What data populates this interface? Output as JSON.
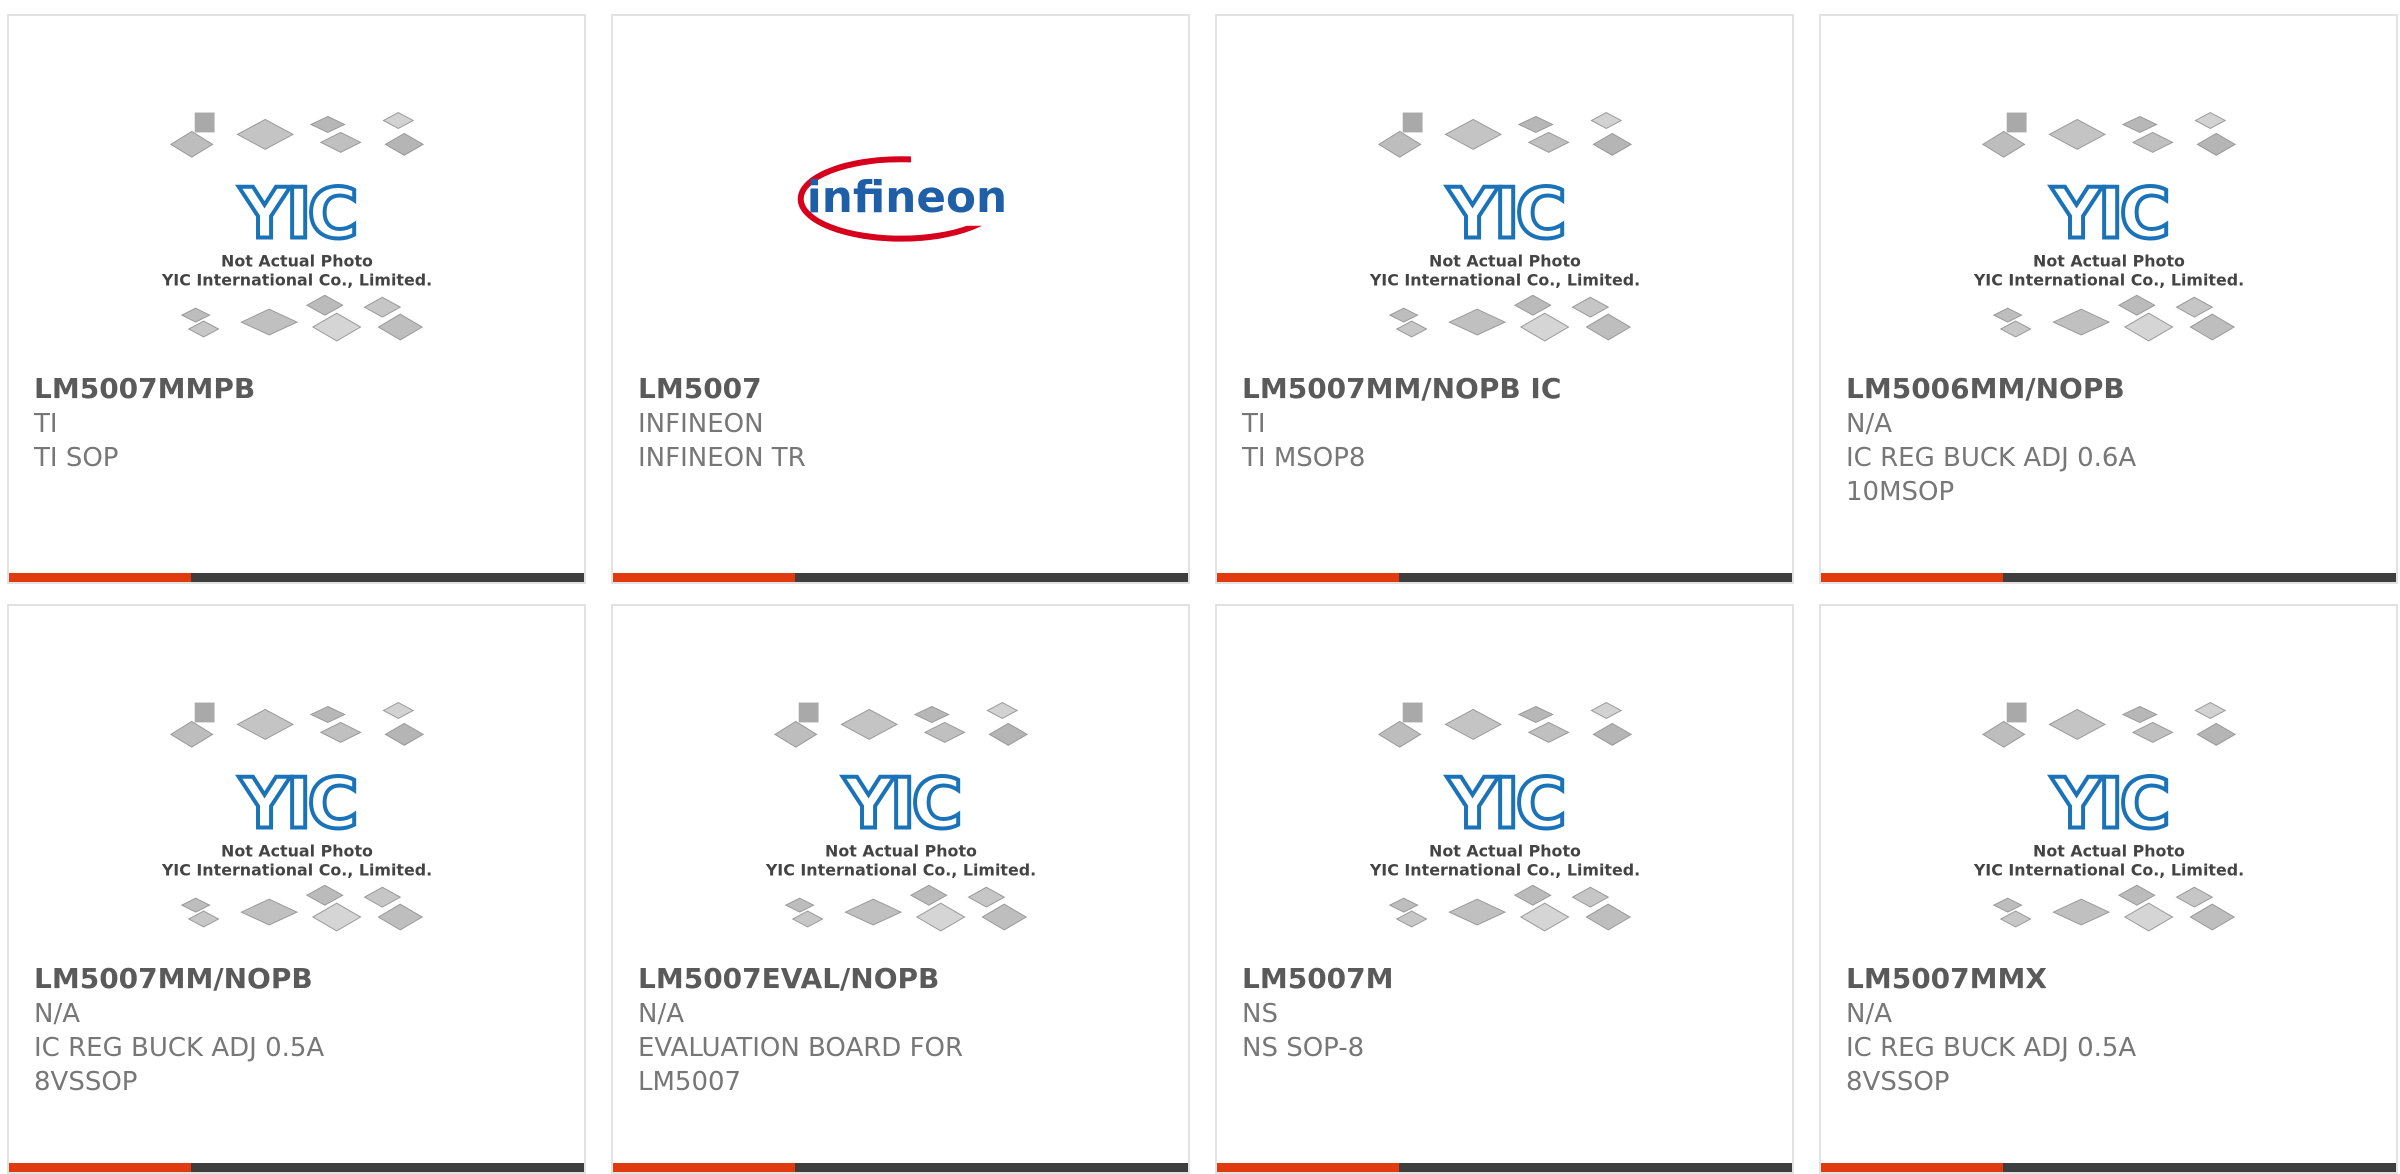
{
  "products": [
    {
      "part": "LM5007MMPB",
      "manufacturer": "TI",
      "description": "TI SOP",
      "image": "yic-placeholder"
    },
    {
      "part": "LM5007",
      "manufacturer": "INFINEON",
      "description": "INFINEON TR",
      "image": "infineon-logo"
    },
    {
      "part": "LM5007MM/NOPB IC",
      "manufacturer": "TI",
      "description": "TI MSOP8",
      "image": "yic-placeholder"
    },
    {
      "part": "LM5006MM/NOPB",
      "manufacturer": "N/A",
      "description": "IC REG BUCK ADJ 0.6A 10MSOP",
      "image": "yic-placeholder"
    },
    {
      "part": "LM5007MM/NOPB",
      "manufacturer": "N/A",
      "description": "IC REG BUCK ADJ 0.5A 8VSSOP",
      "image": "yic-placeholder"
    },
    {
      "part": "LM5007EVAL/NOPB",
      "manufacturer": "N/A",
      "description": "EVALUATION BOARD FOR LM5007",
      "image": "yic-placeholder"
    },
    {
      "part": "LM5007M",
      "manufacturer": "NS",
      "description": "NS SOP-8",
      "image": "yic-placeholder"
    },
    {
      "part": "LM5007MMX",
      "manufacturer": "N/A",
      "description": "IC REG BUCK ADJ 0.5A 8VSSOP",
      "image": "yic-placeholder"
    }
  ],
  "placeholder": {
    "logo_text": "YIC",
    "line1": "Not Actual Photo",
    "line2": "YIC International Co., Limited."
  },
  "infineon_logo_text": "infineon",
  "colors": {
    "accent": "#e23a0f",
    "bar": "#3e3e3e",
    "yic_blue": "#1a73b8",
    "infineon_blue": "#1f5fa8",
    "infineon_red": "#d6001c"
  }
}
